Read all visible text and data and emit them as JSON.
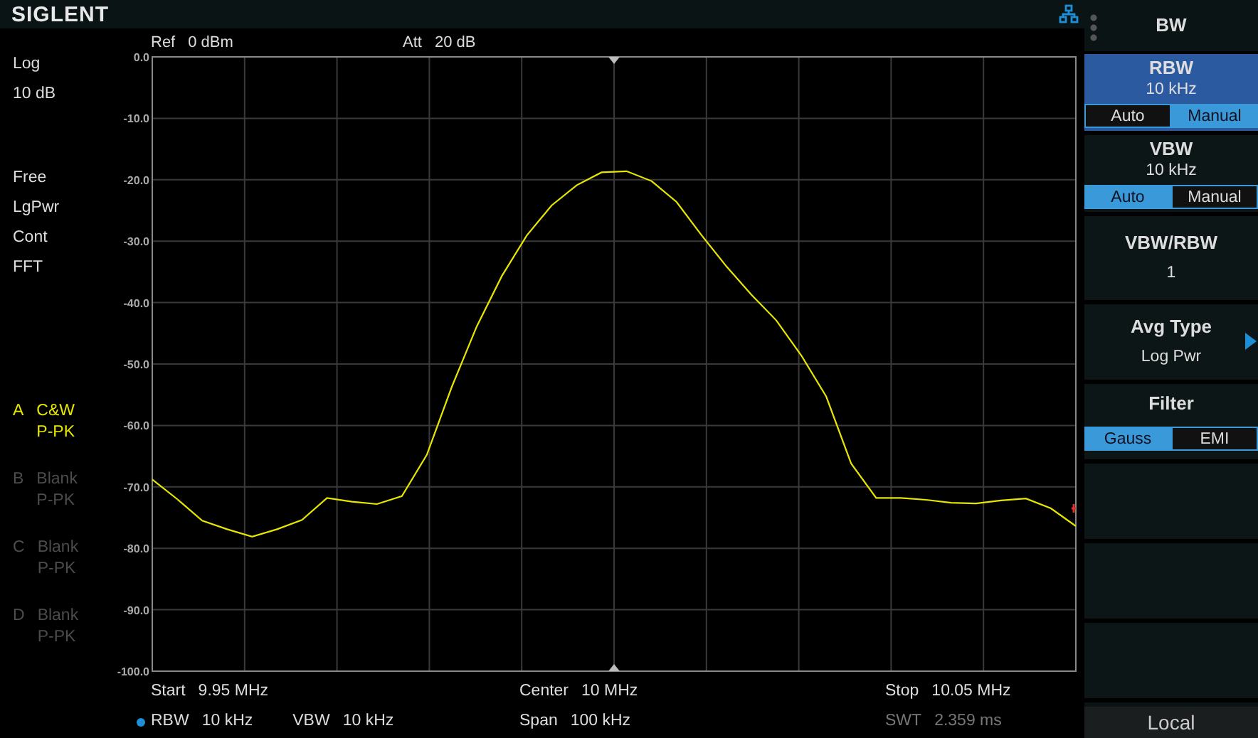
{
  "header": {
    "logo": "SIGLENT"
  },
  "ref_bar": [
    {
      "label": "Ref",
      "value": "0 dBm"
    },
    {
      "label": "Att",
      "value": "20 dB"
    }
  ],
  "scale": [
    "Log",
    "10 dB"
  ],
  "modes": [
    "Free",
    "LgPwr",
    "Cont",
    "FFT"
  ],
  "traces": [
    {
      "letter": "A",
      "name": "C&W",
      "detector": "P-PK",
      "active": true
    },
    {
      "letter": "B",
      "name": "Blank",
      "detector": "P-PK",
      "active": false
    },
    {
      "letter": "C",
      "name": "Blank",
      "detector": "P-PK",
      "active": false
    },
    {
      "letter": "D",
      "name": "Blank",
      "detector": "P-PK",
      "active": false
    }
  ],
  "chart_data": {
    "type": "line",
    "grid": true,
    "ylim": [
      -100,
      0
    ],
    "yticks": [
      {
        "value": 0,
        "label": "0.0"
      },
      {
        "value": -10,
        "label": "-10.0"
      },
      {
        "value": -20,
        "label": "-20.0"
      },
      {
        "value": -30,
        "label": "-30.0"
      },
      {
        "value": -40,
        "label": "-40.0"
      },
      {
        "value": -50,
        "label": "-50.0"
      },
      {
        "value": -60,
        "label": "-60.0"
      },
      {
        "value": -70,
        "label": "-70.0"
      },
      {
        "value": -80,
        "label": "-80.0"
      },
      {
        "value": -90,
        "label": "-90.0"
      },
      {
        "value": -100,
        "label": "-100.0"
      }
    ],
    "categories": [
      null,
      null,
      null,
      null,
      null,
      null,
      null,
      null,
      null,
      null,
      null,
      null,
      null,
      null,
      null,
      null,
      null,
      null,
      null,
      null,
      null,
      null,
      null,
      null,
      null,
      null,
      null,
      null,
      null,
      null,
      null,
      null,
      null,
      null,
      null,
      null,
      null,
      null
    ],
    "series": [
      {
        "color": "#e6e600",
        "values": [
          -68.8,
          -72.0,
          -75.5,
          -76.9,
          -78.1,
          -76.9,
          -75.4,
          -71.8,
          -72.4,
          -72.8,
          -71.5,
          -64.8,
          -53.7,
          -43.9,
          -35.7,
          -29.1,
          -24.2,
          -20.9,
          -18.8,
          -18.6,
          -20.2,
          -23.6,
          -29.0,
          -34.1,
          -38.7,
          -42.9,
          -48.6,
          -55.3,
          -66.2,
          -71.8,
          -71.8,
          -72.1,
          -72.6,
          -72.7,
          -72.2,
          -71.9,
          -73.5,
          -76.4
        ]
      }
    ]
  },
  "footer": [
    [
      [
        {
          "label": "Start",
          "value": "9.95 MHz",
          "marked": false,
          "dimmed": false
        }
      ],
      [
        {
          "label": "RBW",
          "value": "10 kHz",
          "marked": true,
          "dimmed": false
        },
        {
          "label": "VBW",
          "value": "10 kHz",
          "marked": false,
          "dimmed": false
        }
      ]
    ],
    [
      [
        {
          "label": "Center",
          "value": "10 MHz",
          "marked": false,
          "dimmed": false
        }
      ],
      [
        {
          "label": "Span",
          "value": "100 kHz",
          "marked": false,
          "dimmed": false
        }
      ]
    ],
    [
      [
        {
          "label": "Stop",
          "value": "10.05 MHz",
          "marked": false,
          "dimmed": false
        }
      ],
      [
        {
          "label": "SWT",
          "value": "2.359 ms",
          "marked": false,
          "dimmed": true
        }
      ]
    ]
  ],
  "menu": {
    "title": "BW",
    "softkeys": [
      {
        "kind": "toggle",
        "title": "RBW",
        "value": "10 kHz",
        "active": true,
        "options": [
          {
            "label": "Auto",
            "selected": false
          },
          {
            "label": "Manual",
            "selected": true
          }
        ]
      },
      {
        "kind": "toggle",
        "title": "VBW",
        "value": "10 kHz",
        "active": false,
        "options": [
          {
            "label": "Auto",
            "selected": true
          },
          {
            "label": "Manual",
            "selected": false
          }
        ]
      },
      {
        "kind": "value",
        "title": "VBW/RBW",
        "value": "1",
        "active": false
      },
      {
        "kind": "submenu",
        "title": "Avg Type",
        "value": "Log Pwr",
        "active": false
      },
      {
        "kind": "options",
        "title": "Filter",
        "active": false,
        "options": [
          {
            "label": "Gauss",
            "selected": true
          },
          {
            "label": "EMI",
            "selected": false
          }
        ]
      },
      {
        "kind": "empty"
      },
      {
        "kind": "empty"
      },
      {
        "kind": "empty"
      }
    ],
    "local": "Local"
  }
}
